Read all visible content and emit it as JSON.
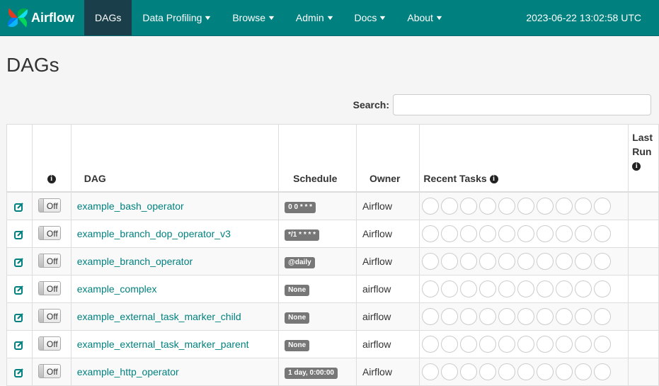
{
  "brand": {
    "name": "Airflow"
  },
  "nav": {
    "items": [
      {
        "label": "DAGs",
        "active": true
      },
      {
        "label": "Data Profiling"
      },
      {
        "label": "Browse"
      },
      {
        "label": "Admin"
      },
      {
        "label": "Docs"
      },
      {
        "label": "About"
      }
    ],
    "time": "2023-06-22 13:02:58 UTC"
  },
  "page": {
    "title": "DAGs"
  },
  "search": {
    "label": "Search:",
    "value": ""
  },
  "table": {
    "headers": {
      "dag": "DAG",
      "schedule": "Schedule",
      "owner": "Owner",
      "recent_tasks": "Recent Tasks",
      "last_run_1": "Last",
      "last_run_2": "Run"
    },
    "rows": [
      {
        "toggle": "Off",
        "dag": "example_bash_operator",
        "schedule": "0 0 * * *",
        "owner": "Airflow"
      },
      {
        "toggle": "Off",
        "dag": "example_branch_dop_operator_v3",
        "schedule": "*/1 * * * *",
        "owner": "Airflow"
      },
      {
        "toggle": "Off",
        "dag": "example_branch_operator",
        "schedule": "@daily",
        "owner": "Airflow"
      },
      {
        "toggle": "Off",
        "dag": "example_complex",
        "schedule": "None",
        "owner": "airflow"
      },
      {
        "toggle": "Off",
        "dag": "example_external_task_marker_child",
        "schedule": "None",
        "owner": "airflow"
      },
      {
        "toggle": "Off",
        "dag": "example_external_task_marker_parent",
        "schedule": "None",
        "owner": "airflow"
      },
      {
        "toggle": "Off",
        "dag": "example_http_operator",
        "schedule": "1 day, 0:00:00",
        "owner": "Airflow"
      }
    ]
  },
  "icons": {
    "edit": "edit-icon",
    "info": "info-icon",
    "logo": "airflow-pinwheel-icon",
    "caret": "chevron-down-icon"
  },
  "colors": {
    "navbar": "#00817f",
    "active_nav": "#1a3f4b",
    "link": "#00817f",
    "badge": "#777777"
  }
}
